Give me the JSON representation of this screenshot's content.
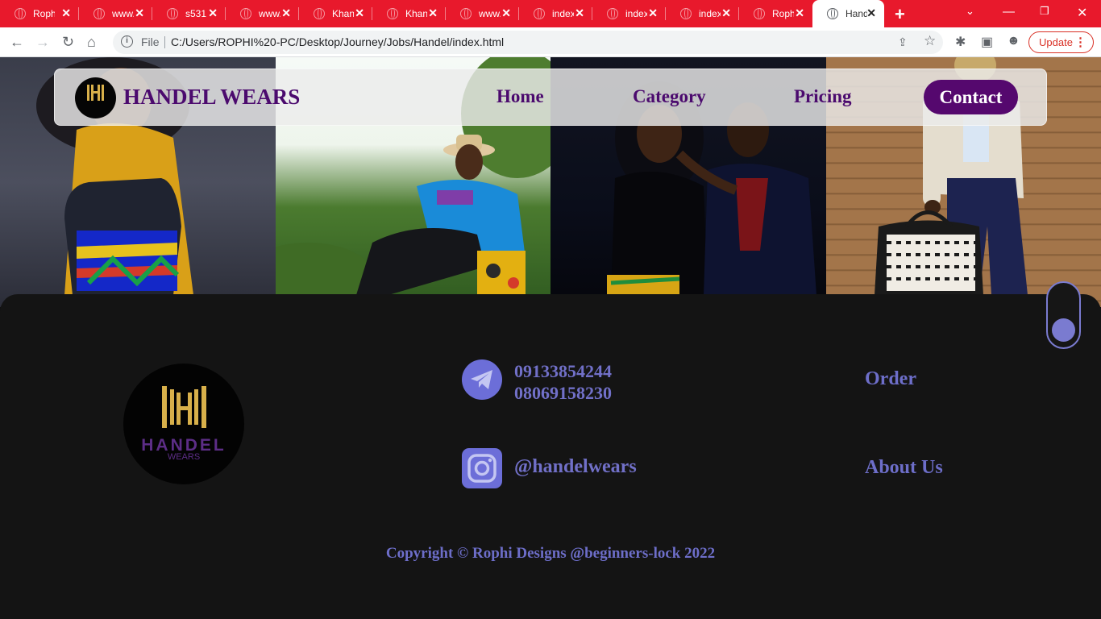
{
  "browser": {
    "tabs": [
      {
        "title": "Rophi"
      },
      {
        "title": "www."
      },
      {
        "title": "s531"
      },
      {
        "title": "www."
      },
      {
        "title": "Khan"
      },
      {
        "title": "Khan"
      },
      {
        "title": "www."
      },
      {
        "title": "index"
      },
      {
        "title": "index"
      },
      {
        "title": "index"
      },
      {
        "title": "Rophi"
      },
      {
        "title": "Handel"
      }
    ],
    "active_tab_index": 11,
    "scheme_label": "File",
    "url": "C:/Users/ROPHI%20-PC/Desktop/Journey/Jobs/Handel/index.html",
    "update_label": "Update"
  },
  "navbar": {
    "brand": "HANDEL WEARS",
    "links": [
      "Home",
      "Category",
      "Pricing"
    ],
    "cta": "Contact"
  },
  "logo": {
    "wordmark": "HANDEL",
    "sub": "WEARS",
    "gold": "#d8b04a",
    "purple": "#5c2d86"
  },
  "footer": {
    "phones": [
      "09133854244",
      "08069158230"
    ],
    "social_handle": "@handelwears",
    "links": [
      "Order",
      "About Us"
    ],
    "copyright": "Copyright © Rophi Designs @beginners-lock 2022"
  },
  "colors": {
    "tabbar_red": "#e8192c",
    "brand_purple": "#4b0a6e",
    "accent_periwinkle": "#6d6ec9",
    "footer_bg": "#141414"
  },
  "icons": {
    "telegram": "paper-plane-icon",
    "instagram": "instagram-icon"
  }
}
